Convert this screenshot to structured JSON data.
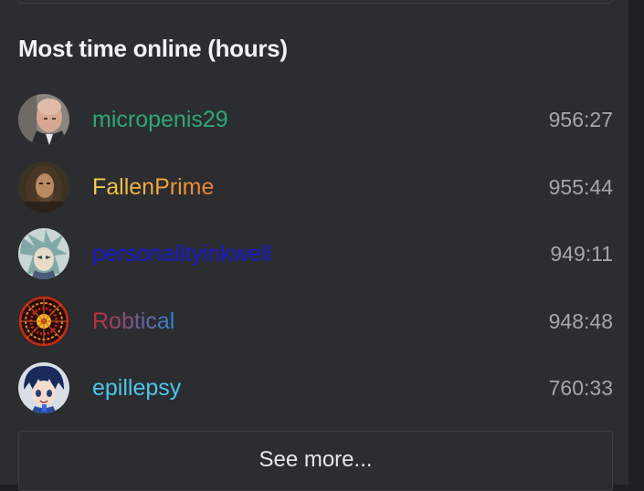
{
  "section": {
    "title": "Most time online (hours)",
    "see_more_label": "See more..."
  },
  "leaderboard": [
    {
      "username": "micropenis29",
      "time": "956:27",
      "name_color": "#2ea774",
      "avatar_icon": "bald-man-avatar"
    },
    {
      "username": "FallenPrime",
      "time": "955:44",
      "name_color": "#f0a23a",
      "avatar_icon": "long-hair-man-avatar"
    },
    {
      "username": "personalityinkwell",
      "time": "949:11",
      "name_color": "#1a1ad0",
      "avatar_icon": "anime-character-avatar"
    },
    {
      "username": "Robtical",
      "time": "948:48",
      "name_color": "#c0353f",
      "avatar_icon": "fractal-pattern-avatar"
    },
    {
      "username": "epillepsy",
      "time": "760:33",
      "name_color": "#4ec5e8",
      "avatar_icon": "anime-boy-avatar"
    }
  ],
  "colors": {
    "background": "#2b2d31",
    "title": "#f2f3f5",
    "time_text": "#a3a6ab"
  }
}
